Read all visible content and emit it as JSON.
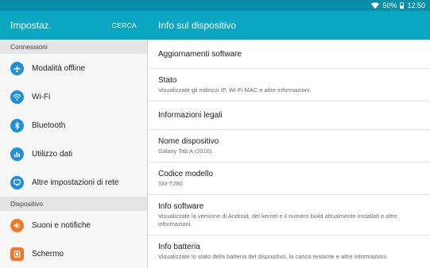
{
  "status_bar": {
    "battery": "50%",
    "time": "12:50"
  },
  "left_header": {
    "title": "Impostaz.",
    "search": "CERCA"
  },
  "right_header": {
    "title": "Info sul dispositivo"
  },
  "sidebar": {
    "sections": [
      {
        "header": "Connessioni",
        "items": [
          {
            "label": "Modalità offline",
            "icon": "airplane-icon"
          },
          {
            "label": "Wi-Fi",
            "icon": "wifi-icon"
          },
          {
            "label": "Bluetooth",
            "icon": "bluetooth-icon"
          },
          {
            "label": "Utilizzo dati",
            "icon": "data-usage-icon"
          },
          {
            "label": "Altre impostazioni di rete",
            "icon": "network-icon"
          }
        ]
      },
      {
        "header": "Dispositivo",
        "items": [
          {
            "label": "Suoni e notifiche",
            "icon": "sound-icon"
          },
          {
            "label": "Schermo",
            "icon": "display-icon"
          }
        ]
      }
    ]
  },
  "detail": {
    "rows": [
      {
        "title": "Aggiornamenti software",
        "subtitle": ""
      },
      {
        "title": "Stato",
        "subtitle": "Visualizzate gli indirizzi IP, Wi-Fi MAC e altre informazioni."
      },
      {
        "title": "Informazioni legali",
        "subtitle": ""
      },
      {
        "title": "Nome dispositivo",
        "subtitle": "Galaxy Tab A (2016)"
      },
      {
        "title": "Codice modello",
        "subtitle": "SM-T280"
      },
      {
        "title": "Info software",
        "subtitle": "Visualizzate la versione di Android, del kernel e il numero build attualmente installati e altre informazioni."
      },
      {
        "title": "Info batteria",
        "subtitle": "Visualizzate lo stato della batteria del dispositivo, la carica restante e altre informazioni."
      }
    ]
  },
  "colors": {
    "header": "#0aa6c2",
    "status_bar": "#0a8fa8",
    "icon_blue": "#1e90d8",
    "icon_orange": "#f07a2a"
  }
}
